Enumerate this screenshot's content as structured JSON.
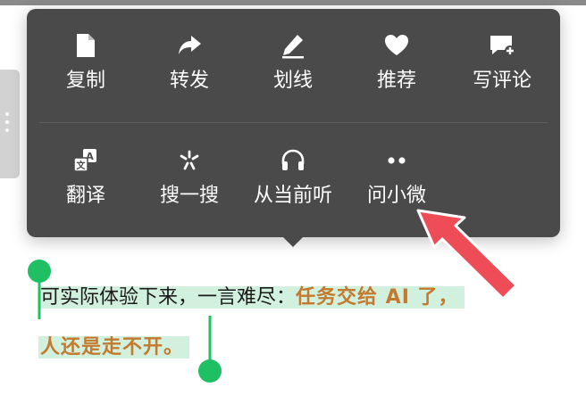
{
  "context_menu": {
    "row_1": [
      {
        "id": "copy",
        "label": "复制",
        "icon": "document-icon"
      },
      {
        "id": "forward",
        "label": "转发",
        "icon": "share-arrow-icon"
      },
      {
        "id": "underline",
        "label": "划线",
        "icon": "pen-icon"
      },
      {
        "id": "recommend",
        "label": "推荐",
        "icon": "heart-icon"
      },
      {
        "id": "comment",
        "label": "写评论",
        "icon": "comment-add-icon"
      }
    ],
    "row_2": [
      {
        "id": "translate",
        "label": "翻译",
        "icon": "translate-icon"
      },
      {
        "id": "search",
        "label": "搜一搜",
        "icon": "search-spark-icon"
      },
      {
        "id": "listen",
        "label": "从当前听",
        "icon": "headphones-icon"
      },
      {
        "id": "ask",
        "label": "问小微",
        "icon": "two-dots-icon"
      }
    ],
    "colors": {
      "background": "#4a4a4a",
      "text": "#ffffff"
    }
  },
  "selected_text": {
    "line_1_plain": "可实际体验下来，一言难尽：",
    "line_1_accent": "任务交给 AI 了，",
    "line_2_accent": "人还是走不开。",
    "colors": {
      "highlight": "#d2f0de",
      "accent": "#c37a2e",
      "handle": "#1fbf63"
    }
  },
  "annotation": {
    "arrow_color": "#ee4d58",
    "points_to": "ask"
  }
}
